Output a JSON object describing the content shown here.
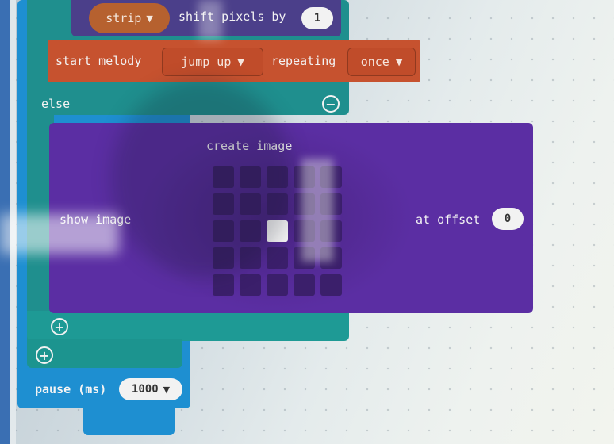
{
  "blocks": {
    "strip": {
      "target_label": "strip",
      "action_label": "shift pixels by",
      "value": "1"
    },
    "melody": {
      "label": "start melody",
      "melody_value": "jump up",
      "repeat_label": "repeating",
      "repeat_value": "once"
    },
    "else_label": "else",
    "show_image": {
      "label": "show image",
      "create_label": "create image",
      "offset_label": "at offset",
      "offset_value": "0",
      "grid": [
        [
          0,
          0,
          0,
          0,
          0
        ],
        [
          0,
          0,
          0,
          0,
          0
        ],
        [
          0,
          0,
          1,
          0,
          0
        ],
        [
          0,
          0,
          0,
          0,
          0
        ],
        [
          0,
          0,
          0,
          0,
          0
        ]
      ]
    },
    "pause": {
      "label": "pause (ms)",
      "value": "1000"
    }
  },
  "colors": {
    "loop_blue": "#1e8fd1",
    "logic_teal": "#1f8f8e",
    "neopixel_purple": "#4b3f8a",
    "music_red": "#c6522f",
    "basic_purple": "#5b2ea3"
  },
  "icons": [
    "dropdown-caret-icon",
    "minus-icon",
    "plus-icon"
  ]
}
